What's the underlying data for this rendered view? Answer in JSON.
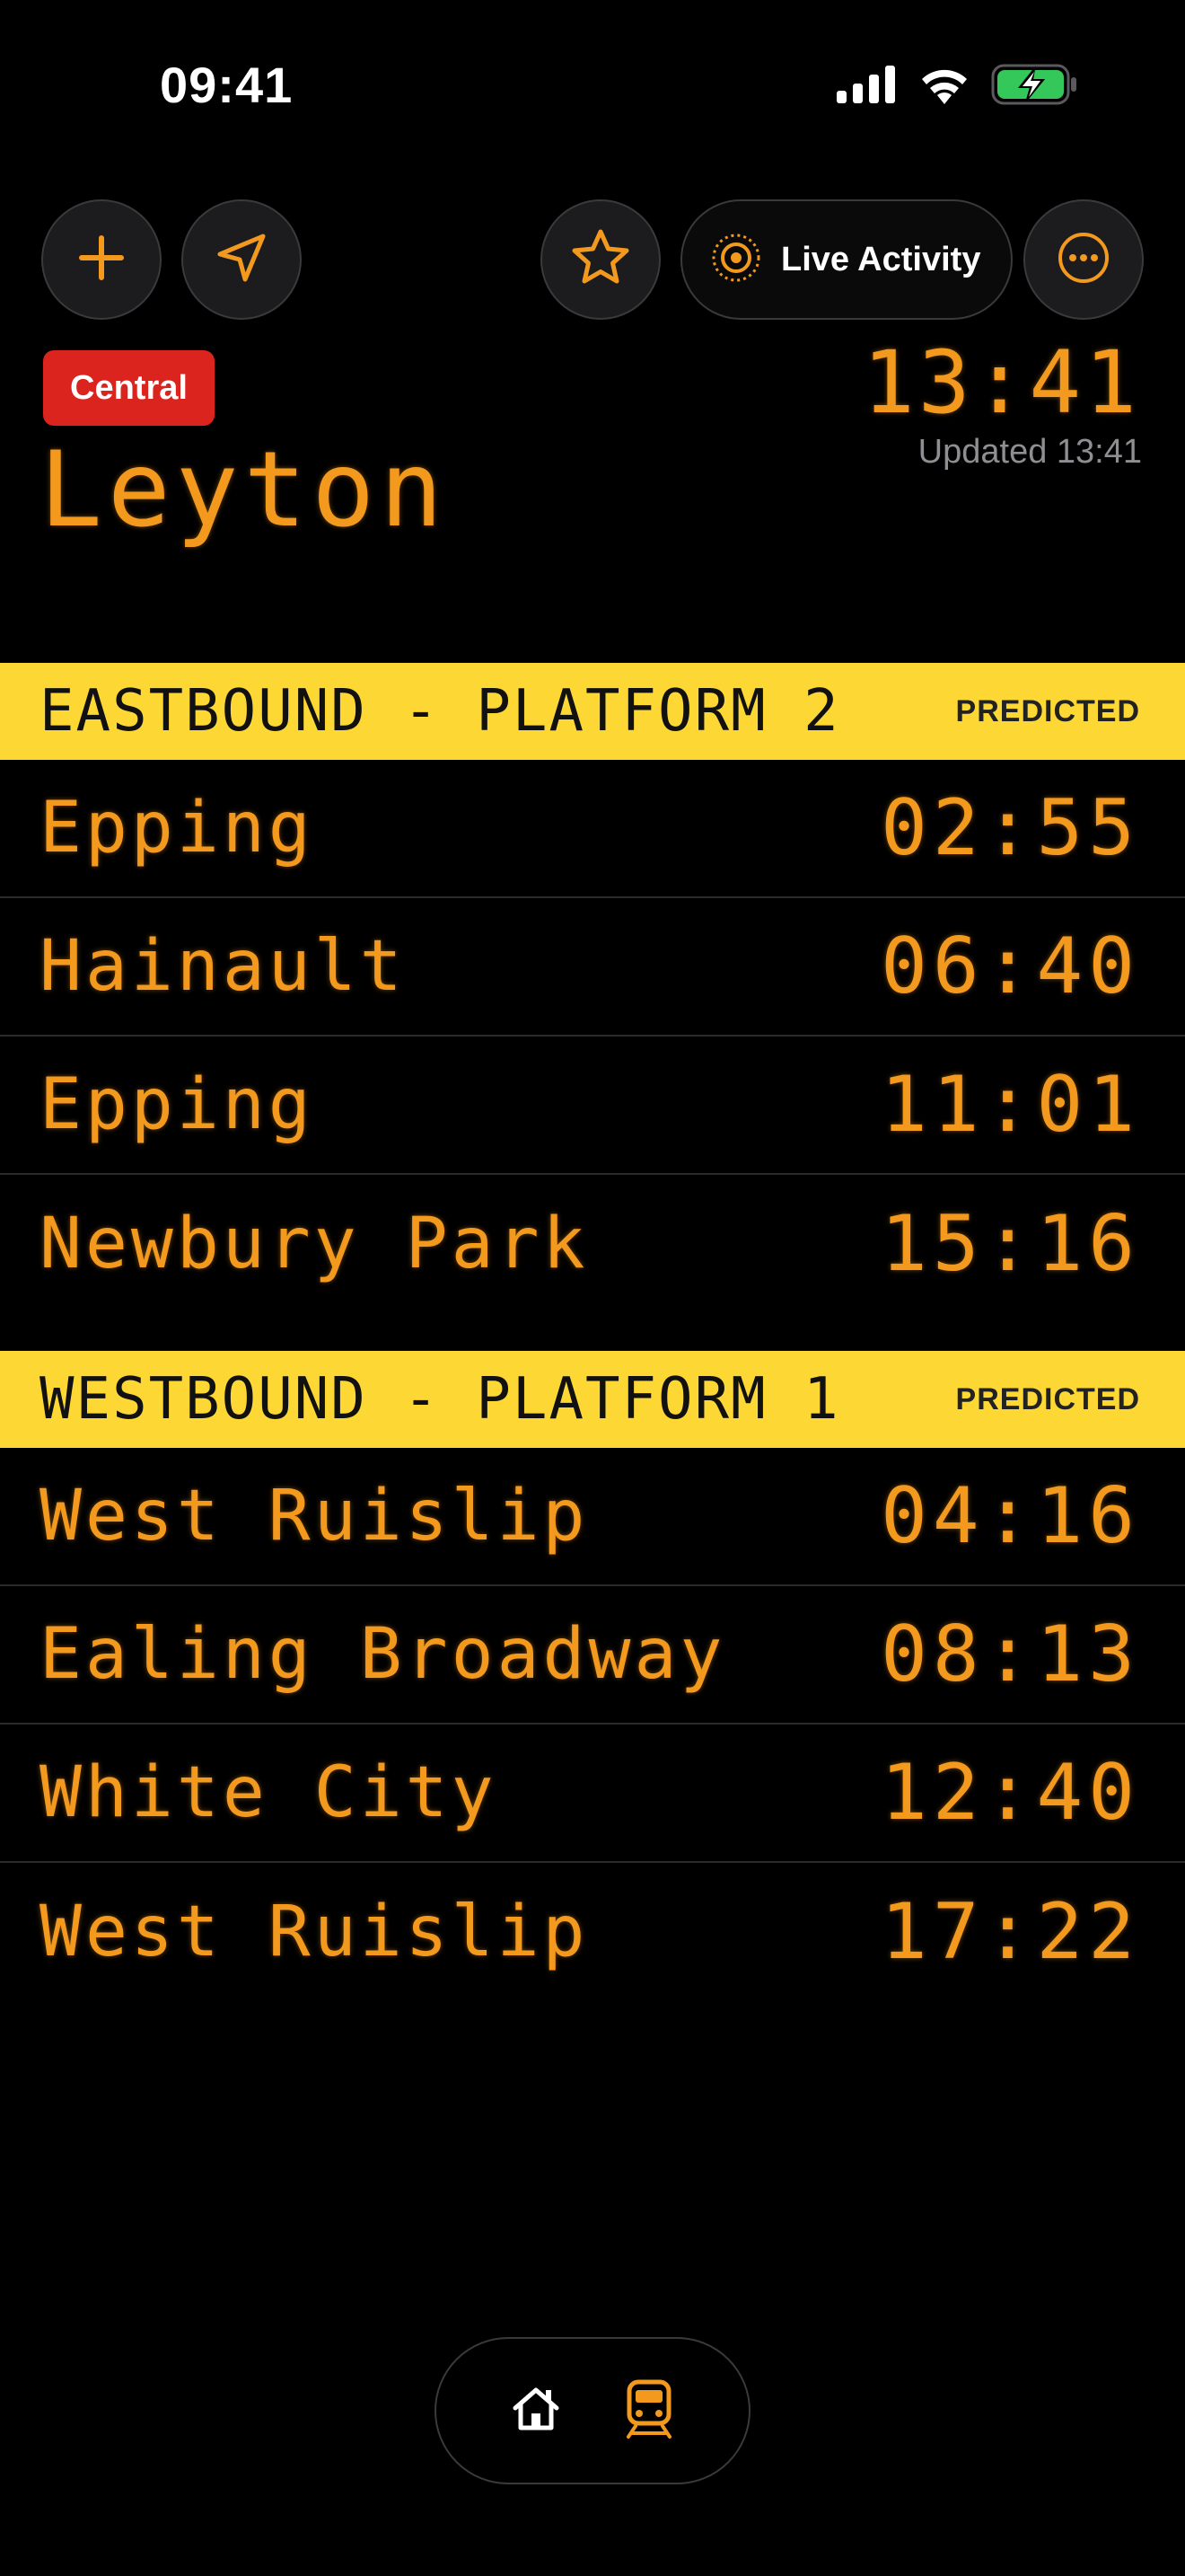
{
  "status_bar": {
    "time": "09:41"
  },
  "toolbar": {
    "add_icon": "plus-icon",
    "location_icon": "location-arrow-icon",
    "favorite_icon": "star-icon",
    "live_activity_label": "Live Activity",
    "more_icon": "ellipsis-icon"
  },
  "header": {
    "line_name": "Central",
    "line_color": "#dc241f",
    "station_name": "Leyton",
    "clock": "13:41",
    "updated_text": "Updated 13:41"
  },
  "platforms": [
    {
      "title": "EASTBOUND - PLATFORM 2",
      "status": "PREDICTED",
      "departures": [
        {
          "destination": "Epping",
          "eta": "02:55"
        },
        {
          "destination": "Hainault",
          "eta": "06:40"
        },
        {
          "destination": "Epping",
          "eta": "11:01"
        },
        {
          "destination": "Newbury Park",
          "eta": "15:16"
        }
      ]
    },
    {
      "title": "WESTBOUND - PLATFORM 1",
      "status": "PREDICTED",
      "departures": [
        {
          "destination": "West Ruislip",
          "eta": "04:16"
        },
        {
          "destination": "Ealing Broadway",
          "eta": "08:13"
        },
        {
          "destination": "White City",
          "eta": "12:40"
        },
        {
          "destination": "West Ruislip",
          "eta": "17:22"
        }
      ]
    }
  ],
  "tabbar": {
    "home_icon": "home-icon",
    "train_icon": "train-icon",
    "selected": "train"
  },
  "colors": {
    "accent_orange": "#f39a1e",
    "platform_header_yellow": "#fdd835",
    "battery_green": "#34c759"
  }
}
